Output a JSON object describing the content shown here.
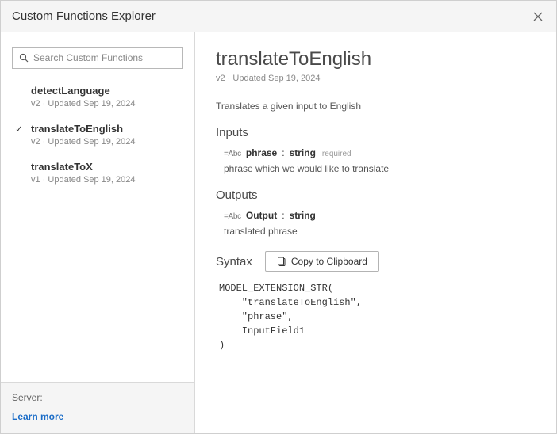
{
  "window": {
    "title": "Custom Functions Explorer"
  },
  "sidebar": {
    "search_placeholder": "Search Custom Functions",
    "items": [
      {
        "name": "detectLanguage",
        "meta": "v2 · Updated Sep 19, 2024",
        "selected": false
      },
      {
        "name": "translateToEnglish",
        "meta": "v2 · Updated Sep 19, 2024",
        "selected": true
      },
      {
        "name": "translateToX",
        "meta": "v1 · Updated Sep 19, 2024",
        "selected": false
      }
    ],
    "footer": {
      "server_label": "Server:",
      "learn_more": "Learn more"
    }
  },
  "detail": {
    "title": "translateToEnglish",
    "subtitle": "v2 · Updated Sep 19, 2024",
    "description": "Translates a given input to English",
    "inputs_heading": "Inputs",
    "inputs": [
      {
        "badge": "Abc",
        "name": "phrase",
        "type": "string",
        "required_label": "required",
        "desc": "phrase which we would like to translate"
      }
    ],
    "outputs_heading": "Outputs",
    "outputs": [
      {
        "badge": "Abc",
        "name": "Output",
        "type": "string",
        "desc": "translated phrase"
      }
    ],
    "syntax_heading": "Syntax",
    "copy_label": "Copy to Clipboard",
    "code": "MODEL_EXTENSION_STR(\n    \"translateToEnglish\",\n    \"phrase\",\n    InputField1\n)"
  }
}
